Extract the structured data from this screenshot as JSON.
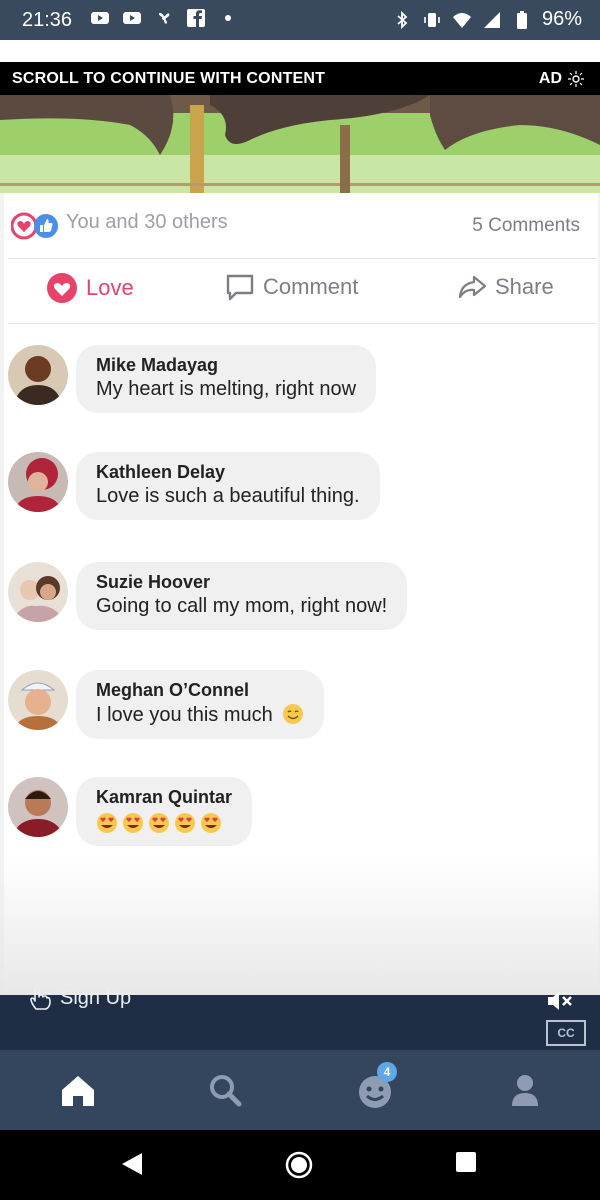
{
  "status_bar": {
    "time": "21:36",
    "battery": "96%"
  },
  "ad_bar": {
    "label": "SCROLL TO CONTINUE WITH CONTENT",
    "ad_label": "AD"
  },
  "post": {
    "reactions_text": "You and 30 others",
    "comments_count": "5 Comments",
    "actions": {
      "love": "Love",
      "comment": "Comment",
      "share": "Share"
    }
  },
  "comments": [
    {
      "name": "Mike Madayag",
      "text": "My heart is melting, right now"
    },
    {
      "name": "Kathleen Delay",
      "text": "Love is such a beautiful thing."
    },
    {
      "name": "Suzie Hoover",
      "text": "Going to call my mom, right now!"
    },
    {
      "name": "Meghan O’Connel",
      "text": "I love you this much"
    },
    {
      "name": "Kamran Quintar",
      "emojis": [
        "heart-eyes-emoji",
        "heart-eyes-emoji",
        "heart-eyes-emoji",
        "heart-eyes-emoji",
        "heart-eyes-emoji"
      ]
    }
  ],
  "video_overlay": {
    "signup": "Sign Up",
    "cc": "CC"
  },
  "bottom_nav": {
    "notification_badge": "4"
  },
  "colors": {
    "love": "#e8416a",
    "nav_bg": "#34465d",
    "status_bg": "#3a4a5e",
    "badge": "#5fa8e5"
  }
}
